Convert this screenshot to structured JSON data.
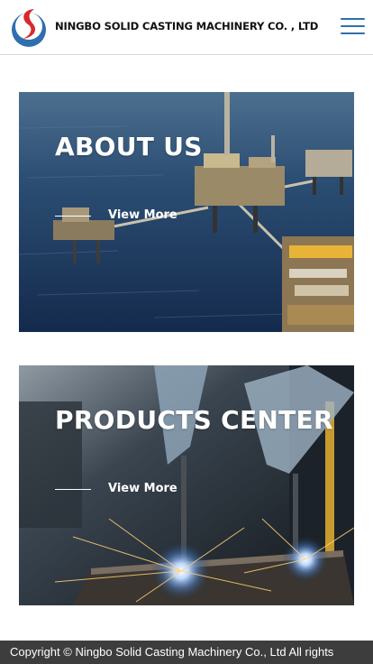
{
  "header": {
    "company_name": "NINGBO SOLID CASTING MACHINERY CO. , LTD",
    "logo_icon": "solid-casting-logo",
    "menu_icon": "hamburger-menu-icon"
  },
  "colors": {
    "brand_red": "#d8282e",
    "brand_blue": "#2f6fae",
    "menu_blue": "#2f6fae",
    "footer_bg": "#3d3d3d"
  },
  "cards": [
    {
      "title": "ABOUT US",
      "link_label": "View More",
      "image": "offshore-oil-platform"
    },
    {
      "title": "PRODUCTS CENTER",
      "link_label": "View More",
      "image": "welding-sparks"
    }
  ],
  "footer": {
    "copyright": "Copyright © Ningbo Solid Casting Machinery Co., Ltd All rights"
  }
}
